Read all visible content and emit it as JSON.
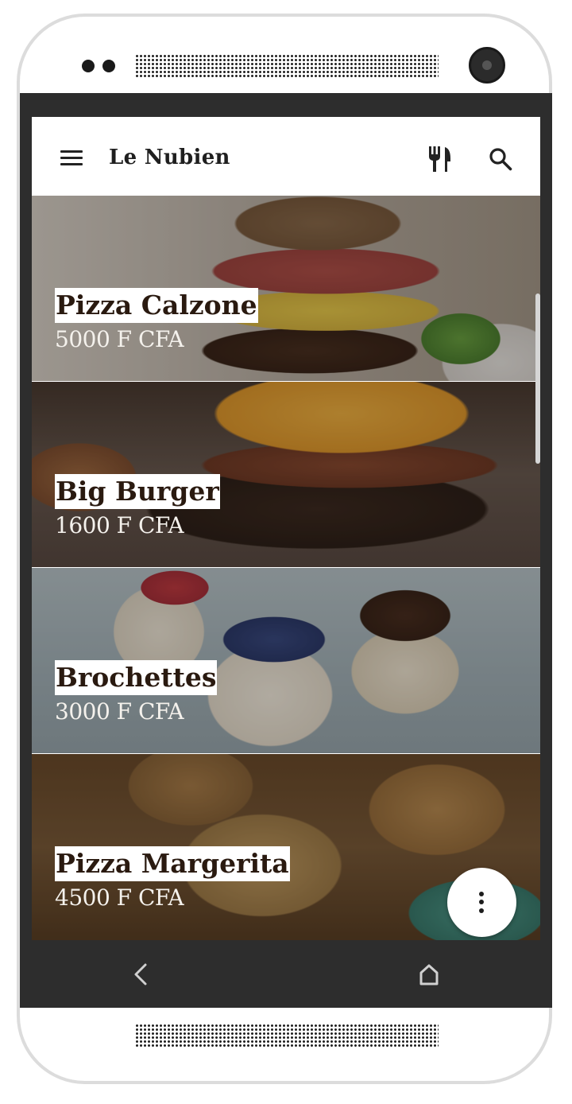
{
  "app": {
    "title": "Le Nubien"
  },
  "toolbar": {
    "menu_icon": "menu-icon",
    "cutlery_icon": "cutlery-icon",
    "search_icon": "search-icon"
  },
  "menu_items": [
    {
      "name": "Pizza Calzone",
      "price": "5000 F CFA"
    },
    {
      "name": "Big Burger",
      "price": "1600 F CFA"
    },
    {
      "name": "Brochettes",
      "price": "3000 F CFA"
    },
    {
      "name": "Pizza Margerita",
      "price": "4500 F CFA"
    }
  ],
  "fab": {
    "icon": "more-vertical-icon"
  },
  "system_nav": {
    "back_icon": "back-icon",
    "home_icon": "home-icon"
  },
  "colors": {
    "appbar_bg": "#ffffff",
    "title_text": "#1f1f1f",
    "name_text": "#2a1a10",
    "price_text": "#f4f1ec",
    "device_frame": "#2d2d2d"
  }
}
